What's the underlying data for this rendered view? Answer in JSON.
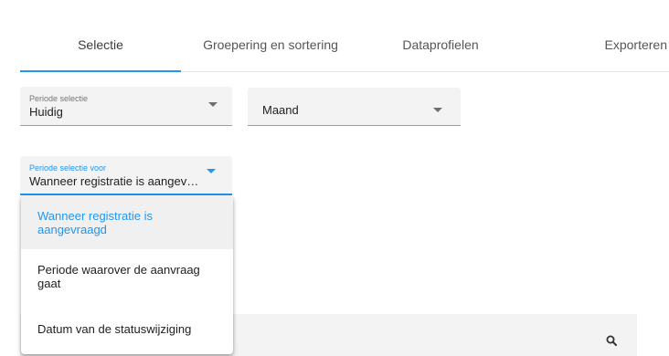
{
  "tabs": [
    {
      "label": "Selectie",
      "active": true
    },
    {
      "label": "Groepering en sortering",
      "active": false
    },
    {
      "label": "Dataprofielen",
      "active": false
    },
    {
      "label": "Exporteren",
      "active": false
    }
  ],
  "filters": {
    "periode": {
      "label": "Periode selectie",
      "value": "Huidig"
    },
    "interval": {
      "value": "Maand"
    },
    "periode_voor": {
      "label": "Periode selectie voor",
      "value": "Wanneer registratie is aangevraagd"
    }
  },
  "dropdown": {
    "options": [
      {
        "label": "Wanneer registratie is aangevraagd",
        "selected": true
      },
      {
        "label": "Periode waarover de aanvraag gaat",
        "selected": false
      },
      {
        "label": "Datum van de statuswijziging",
        "selected": false
      }
    ]
  },
  "search": {
    "icon": "search-icon"
  },
  "colors": {
    "accent": "#2196f3",
    "field_bg": "#f3f3f3"
  }
}
